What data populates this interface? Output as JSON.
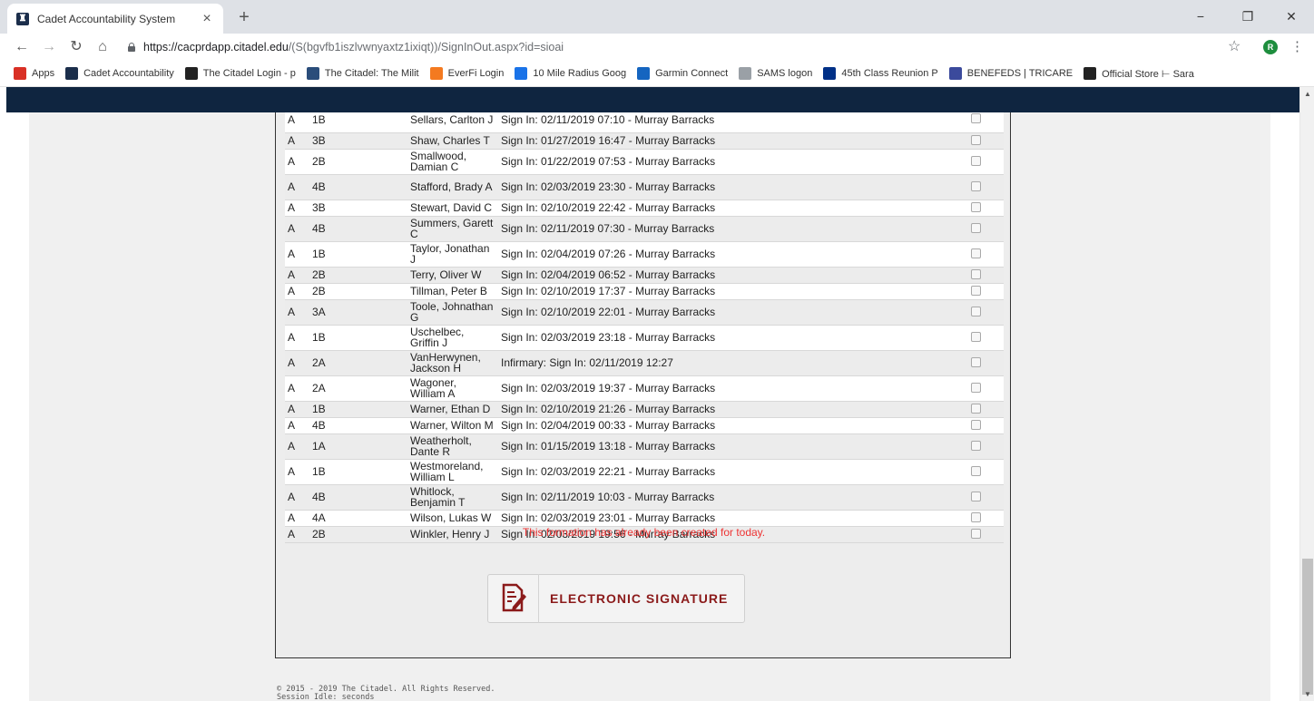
{
  "browser": {
    "tab_title": "Cadet Accountability System",
    "tab_close": "×",
    "new_tab": "+",
    "url_host": "https://cacprdapp.citadel.edu",
    "url_path": "/(S(bgvfb1iszlvwnyaxtz1ixiqt))/SignInOut.aspx?id=sioai",
    "profile_initial": "R",
    "window_controls": [
      "−",
      "❐",
      "✕"
    ],
    "bookmarks": [
      {
        "label": "Apps",
        "icon": "apps-grid-icon",
        "color": "#d93025"
      },
      {
        "label": "Cadet Accountability",
        "icon": "citadel-icon",
        "color": "#1b2e4b"
      },
      {
        "label": "The Citadel Login - p",
        "icon": "building-icon",
        "color": "#222222"
      },
      {
        "label": "The Citadel: The Milit",
        "icon": "building-icon",
        "color": "#2a4d7a"
      },
      {
        "label": "EverFi Login",
        "icon": "everfi-icon",
        "color": "#f47a20"
      },
      {
        "label": "10 Mile Radius Goog",
        "icon": "map-icon",
        "color": "#1a73e8"
      },
      {
        "label": "Garmin Connect",
        "icon": "garmin-icon",
        "color": "#1565c0"
      },
      {
        "label": "SAMS logon",
        "icon": "sams-icon",
        "color": "#9aa0a6"
      },
      {
        "label": "45th Class Reunion P",
        "icon": "paypal-icon",
        "color": "#003087"
      },
      {
        "label": "BENEFEDS | TRICARE",
        "icon": "benefeds-icon",
        "color": "#3b4a9c"
      },
      {
        "label": "Official Store ⊢ Sara",
        "icon": "store-icon",
        "color": "#222222"
      }
    ]
  },
  "rows": [
    {
      "co": "A",
      "cl": "1B",
      "name": "Sellars, Carlton J",
      "status": "Sign In: 02/11/2019 07:10 - Murray Barracks"
    },
    {
      "co": "A",
      "cl": "3B",
      "name": "Shaw, Charles T",
      "status": "Sign In: 01/27/2019 16:47 - Murray Barracks"
    },
    {
      "co": "A",
      "cl": "2B",
      "name": "Smallwood, Damian C",
      "status": "Sign In: 01/22/2019 07:53 - Murray Barracks"
    },
    {
      "co": "A",
      "cl": "4B",
      "name": "Stafford, Brady A",
      "status": "Sign In: 02/03/2019 23:30 - Murray Barracks"
    },
    {
      "co": "A",
      "cl": "3B",
      "name": "Stewart, David C",
      "status": "Sign In: 02/10/2019 22:42 - Murray Barracks"
    },
    {
      "co": "A",
      "cl": "4B",
      "name": "Summers, Garett C",
      "status": "Sign In: 02/11/2019 07:30 - Murray Barracks"
    },
    {
      "co": "A",
      "cl": "1B",
      "name": "Taylor, Jonathan J",
      "status": "Sign In: 02/04/2019 07:26 - Murray Barracks"
    },
    {
      "co": "A",
      "cl": "2B",
      "name": "Terry, Oliver W",
      "status": "Sign In: 02/04/2019 06:52 - Murray Barracks"
    },
    {
      "co": "A",
      "cl": "2B",
      "name": "Tillman, Peter B",
      "status": "Sign In: 02/10/2019 17:37 - Murray Barracks"
    },
    {
      "co": "A",
      "cl": "3A",
      "name": "Toole, Johnathan G",
      "status": "Sign In: 02/10/2019 22:01 - Murray Barracks"
    },
    {
      "co": "A",
      "cl": "1B",
      "name": "Uschelbec, Griffin J",
      "status": "Sign In: 02/03/2019 23:18 - Murray Barracks"
    },
    {
      "co": "A",
      "cl": "2A",
      "name": "VanHerwynen, Jackson H",
      "status": "Infirmary: Sign In: 02/11/2019 12:27"
    },
    {
      "co": "A",
      "cl": "2A",
      "name": "Wagoner, William A",
      "status": "Sign In: 02/03/2019 19:37 - Murray Barracks"
    },
    {
      "co": "A",
      "cl": "1B",
      "name": "Warner, Ethan D",
      "status": "Sign In: 02/10/2019 21:26 - Murray Barracks"
    },
    {
      "co": "A",
      "cl": "4B",
      "name": "Warner, Wilton M",
      "status": "Sign In: 02/04/2019 00:33 - Murray Barracks"
    },
    {
      "co": "A",
      "cl": "1A",
      "name": "Weatherholt, Dante R",
      "status": "Sign In: 01/15/2019 13:18 - Murray Barracks"
    },
    {
      "co": "A",
      "cl": "1B",
      "name": "Westmoreland, William L",
      "status": "Sign In: 02/03/2019 22:21 - Murray Barracks"
    },
    {
      "co": "A",
      "cl": "4B",
      "name": "Whitlock, Benjamin T",
      "status": "Sign In: 02/11/2019 10:03 - Murray Barracks"
    },
    {
      "co": "A",
      "cl": "4A",
      "name": "Wilson, Lukas W",
      "status": "Sign In: 02/03/2019 23:01 - Murray Barracks"
    },
    {
      "co": "A",
      "cl": "2B",
      "name": "Winkler, Henry J",
      "status": "Sign In: 02/03/2019 19:56 - Murray Barracks"
    }
  ],
  "message": "This formation has already been created for today.",
  "signature_button": {
    "label": "ELECTRONIC SIGNATURE",
    "icon": "signature-pen-icon"
  },
  "footer": {
    "copyright": "© 2015 - 2019 The Citadel. All Rights Reserved.",
    "session": "Session Idle:  seconds"
  },
  "colors": {
    "navbar": "#0f2540",
    "message": "#ee3333",
    "signature_text": "#8b1a1a"
  }
}
